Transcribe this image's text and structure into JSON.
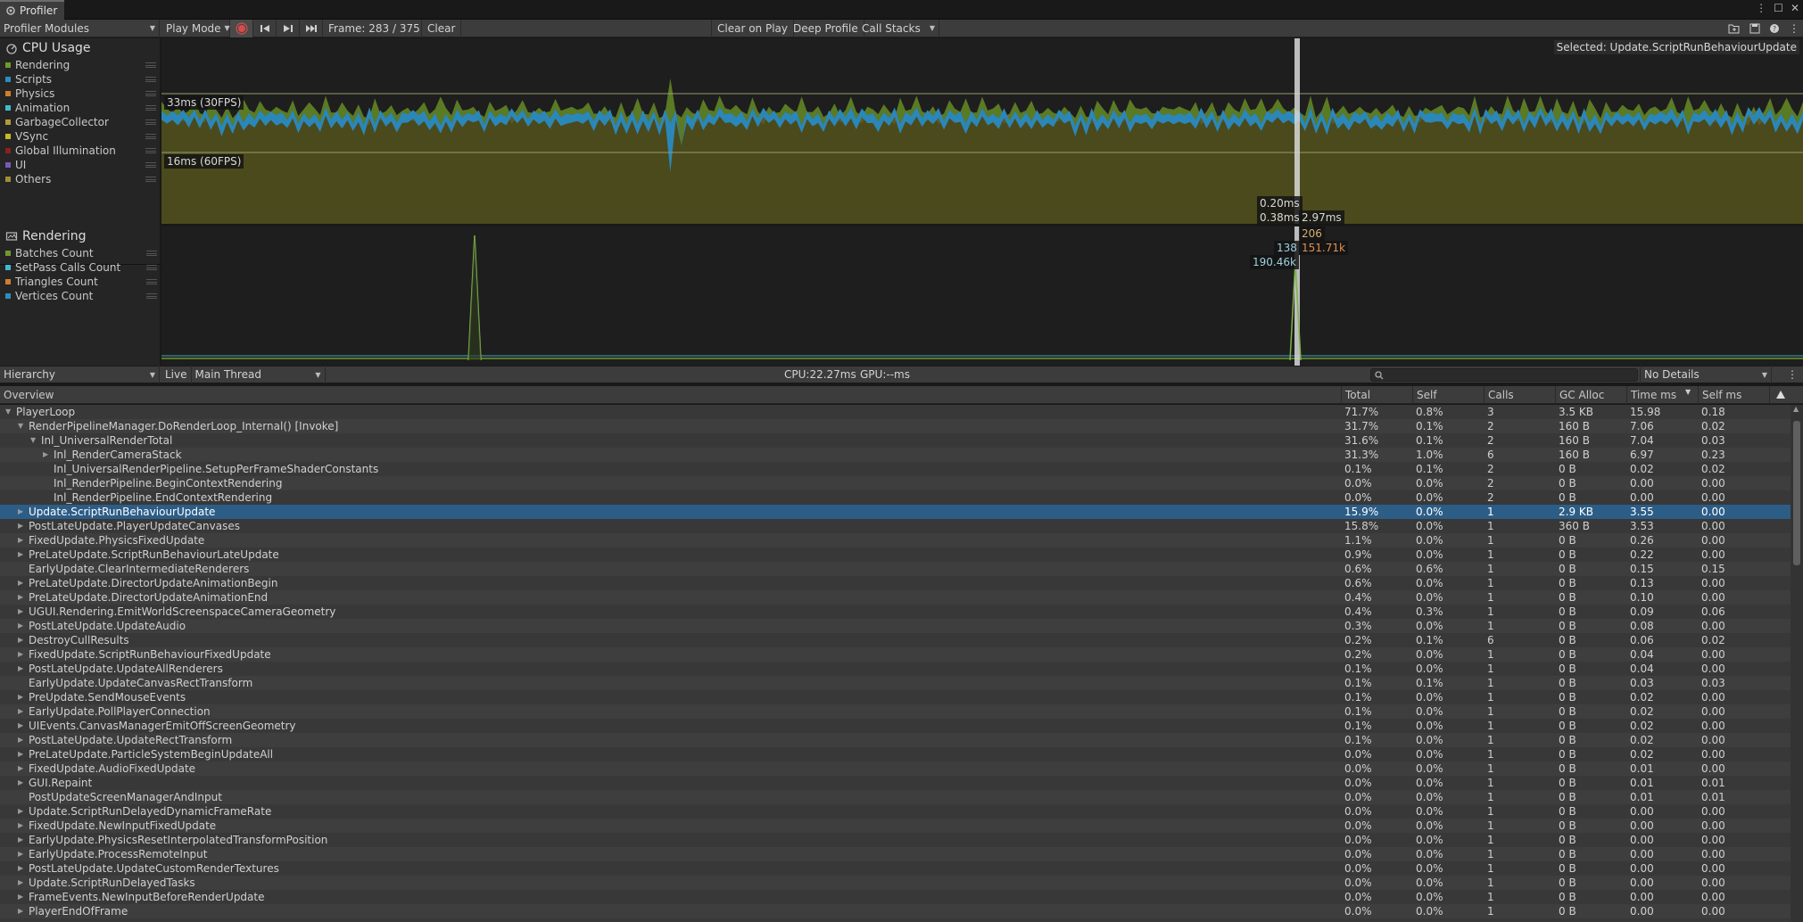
{
  "window": {
    "tab_title": "Profiler"
  },
  "toolbar": {
    "modules_dropdown": "Profiler Modules",
    "play_mode": "Play Mode",
    "frame": "Frame: 283 / 375",
    "clear": "Clear",
    "clear_on_play": "Clear on Play",
    "deep_profile": "Deep Profile",
    "call_stacks": "Call Stacks"
  },
  "cpu_module": {
    "title": "CPU Usage",
    "legend": [
      {
        "label": "Rendering",
        "color": "#6f9a2b"
      },
      {
        "label": "Scripts",
        "color": "#2a8fbf"
      },
      {
        "label": "Physics",
        "color": "#d27d2c"
      },
      {
        "label": "Animation",
        "color": "#3fbad0"
      },
      {
        "label": "GarbageCollector",
        "color": "#b59a3d"
      },
      {
        "label": "VSync",
        "color": "#c9b925"
      },
      {
        "label": "Global Illumination",
        "color": "#8a2020"
      },
      {
        "label": "UI",
        "color": "#7a58b7"
      },
      {
        "label": "Others",
        "color": "#9e8d36"
      }
    ],
    "line_30fps": "33ms (30FPS)",
    "line_60fps": "16ms (60FPS)",
    "selected": "Selected: Update.ScriptRunBehaviourUpdate",
    "values": [
      "0.20ms",
      "0.38ms",
      "2.97ms"
    ]
  },
  "render_module": {
    "title": "Rendering",
    "legend": [
      {
        "label": "Batches Count",
        "color": "#6f9a2b"
      },
      {
        "label": "SetPass Calls Count",
        "color": "#3fbad0"
      },
      {
        "label": "Triangles Count",
        "color": "#d27d2c"
      },
      {
        "label": "Vertices Count",
        "color": "#2a8fbf"
      }
    ],
    "values": [
      "206",
      "138",
      "151.71k",
      "190.46k"
    ]
  },
  "details_bar": {
    "view": "Hierarchy",
    "live": "Live",
    "thread": "Main Thread",
    "cpu": "CPU:22.27ms",
    "gpu": "GPU:--ms",
    "details": "No Details"
  },
  "columns": [
    "Overview",
    "Total",
    "Self",
    "Calls",
    "GC Alloc",
    "Time ms",
    "Self ms"
  ],
  "rows": [
    {
      "name": "PlayerLoop",
      "depth": 0,
      "exp": "open",
      "total": "71.7%",
      "self": "0.8%",
      "calls": "3",
      "gc": "3.5 KB",
      "time": "15.98",
      "selfms": "0.18"
    },
    {
      "name": "RenderPipelineManager.DoRenderLoop_Internal() [Invoke]",
      "depth": 1,
      "exp": "open",
      "total": "31.7%",
      "self": "0.1%",
      "calls": "2",
      "gc": "160 B",
      "time": "7.06",
      "selfms": "0.02"
    },
    {
      "name": "Inl_UniversalRenderTotal",
      "depth": 2,
      "exp": "open",
      "total": "31.6%",
      "self": "0.1%",
      "calls": "2",
      "gc": "160 B",
      "time": "7.04",
      "selfms": "0.03"
    },
    {
      "name": "Inl_RenderCameraStack",
      "depth": 3,
      "exp": "closed",
      "total": "31.3%",
      "self": "1.0%",
      "calls": "6",
      "gc": "160 B",
      "time": "6.97",
      "selfms": "0.23"
    },
    {
      "name": "Inl_UniversalRenderPipeline.SetupPerFrameShaderConstants",
      "depth": 3,
      "exp": "none",
      "total": "0.1%",
      "self": "0.1%",
      "calls": "2",
      "gc": "0 B",
      "time": "0.02",
      "selfms": "0.02"
    },
    {
      "name": "Inl_RenderPipeline.BeginContextRendering",
      "depth": 3,
      "exp": "none",
      "total": "0.0%",
      "self": "0.0%",
      "calls": "2",
      "gc": "0 B",
      "time": "0.00",
      "selfms": "0.00"
    },
    {
      "name": "Inl_RenderPipeline.EndContextRendering",
      "depth": 3,
      "exp": "none",
      "total": "0.0%",
      "self": "0.0%",
      "calls": "2",
      "gc": "0 B",
      "time": "0.00",
      "selfms": "0.00"
    },
    {
      "name": "Update.ScriptRunBehaviourUpdate",
      "depth": 1,
      "exp": "closed",
      "total": "15.9%",
      "self": "0.0%",
      "calls": "1",
      "gc": "2.9 KB",
      "time": "3.55",
      "selfms": "0.00",
      "selected": true
    },
    {
      "name": "PostLateUpdate.PlayerUpdateCanvases",
      "depth": 1,
      "exp": "closed",
      "total": "15.8%",
      "self": "0.0%",
      "calls": "1",
      "gc": "360 B",
      "time": "3.53",
      "selfms": "0.00"
    },
    {
      "name": "FixedUpdate.PhysicsFixedUpdate",
      "depth": 1,
      "exp": "closed",
      "total": "1.1%",
      "self": "0.0%",
      "calls": "1",
      "gc": "0 B",
      "time": "0.26",
      "selfms": "0.00"
    },
    {
      "name": "PreLateUpdate.ScriptRunBehaviourLateUpdate",
      "depth": 1,
      "exp": "closed",
      "total": "0.9%",
      "self": "0.0%",
      "calls": "1",
      "gc": "0 B",
      "time": "0.22",
      "selfms": "0.00"
    },
    {
      "name": "EarlyUpdate.ClearIntermediateRenderers",
      "depth": 1,
      "exp": "none",
      "total": "0.6%",
      "self": "0.6%",
      "calls": "1",
      "gc": "0 B",
      "time": "0.15",
      "selfms": "0.15"
    },
    {
      "name": "PreLateUpdate.DirectorUpdateAnimationBegin",
      "depth": 1,
      "exp": "closed",
      "total": "0.6%",
      "self": "0.0%",
      "calls": "1",
      "gc": "0 B",
      "time": "0.13",
      "selfms": "0.00"
    },
    {
      "name": "PreLateUpdate.DirectorUpdateAnimationEnd",
      "depth": 1,
      "exp": "closed",
      "total": "0.4%",
      "self": "0.0%",
      "calls": "1",
      "gc": "0 B",
      "time": "0.10",
      "selfms": "0.00"
    },
    {
      "name": "UGUI.Rendering.EmitWorldScreenspaceCameraGeometry",
      "depth": 1,
      "exp": "closed",
      "total": "0.4%",
      "self": "0.3%",
      "calls": "1",
      "gc": "0 B",
      "time": "0.09",
      "selfms": "0.06"
    },
    {
      "name": "PostLateUpdate.UpdateAudio",
      "depth": 1,
      "exp": "closed",
      "total": "0.3%",
      "self": "0.0%",
      "calls": "1",
      "gc": "0 B",
      "time": "0.08",
      "selfms": "0.00"
    },
    {
      "name": "DestroyCullResults",
      "depth": 1,
      "exp": "closed",
      "total": "0.2%",
      "self": "0.1%",
      "calls": "6",
      "gc": "0 B",
      "time": "0.06",
      "selfms": "0.02"
    },
    {
      "name": "FixedUpdate.ScriptRunBehaviourFixedUpdate",
      "depth": 1,
      "exp": "closed",
      "total": "0.2%",
      "self": "0.0%",
      "calls": "1",
      "gc": "0 B",
      "time": "0.04",
      "selfms": "0.00"
    },
    {
      "name": "PostLateUpdate.UpdateAllRenderers",
      "depth": 1,
      "exp": "closed",
      "total": "0.1%",
      "self": "0.0%",
      "calls": "1",
      "gc": "0 B",
      "time": "0.04",
      "selfms": "0.00"
    },
    {
      "name": "EarlyUpdate.UpdateCanvasRectTransform",
      "depth": 1,
      "exp": "none",
      "total": "0.1%",
      "self": "0.1%",
      "calls": "1",
      "gc": "0 B",
      "time": "0.03",
      "selfms": "0.03"
    },
    {
      "name": "PreUpdate.SendMouseEvents",
      "depth": 1,
      "exp": "closed",
      "total": "0.1%",
      "self": "0.0%",
      "calls": "1",
      "gc": "0 B",
      "time": "0.02",
      "selfms": "0.00"
    },
    {
      "name": "EarlyUpdate.PollPlayerConnection",
      "depth": 1,
      "exp": "closed",
      "total": "0.1%",
      "self": "0.0%",
      "calls": "1",
      "gc": "0 B",
      "time": "0.02",
      "selfms": "0.00"
    },
    {
      "name": "UIEvents.CanvasManagerEmitOffScreenGeometry",
      "depth": 1,
      "exp": "closed",
      "total": "0.1%",
      "self": "0.0%",
      "calls": "1",
      "gc": "0 B",
      "time": "0.02",
      "selfms": "0.00"
    },
    {
      "name": "PostLateUpdate.UpdateRectTransform",
      "depth": 1,
      "exp": "closed",
      "total": "0.1%",
      "self": "0.0%",
      "calls": "1",
      "gc": "0 B",
      "time": "0.02",
      "selfms": "0.00"
    },
    {
      "name": "PreLateUpdate.ParticleSystemBeginUpdateAll",
      "depth": 1,
      "exp": "closed",
      "total": "0.0%",
      "self": "0.0%",
      "calls": "1",
      "gc": "0 B",
      "time": "0.02",
      "selfms": "0.00"
    },
    {
      "name": "FixedUpdate.AudioFixedUpdate",
      "depth": 1,
      "exp": "closed",
      "total": "0.0%",
      "self": "0.0%",
      "calls": "1",
      "gc": "0 B",
      "time": "0.01",
      "selfms": "0.00"
    },
    {
      "name": "GUI.Repaint",
      "depth": 1,
      "exp": "closed",
      "total": "0.0%",
      "self": "0.0%",
      "calls": "1",
      "gc": "0 B",
      "time": "0.01",
      "selfms": "0.01"
    },
    {
      "name": "PostUpdateScreenManagerAndInput",
      "depth": 1,
      "exp": "none",
      "total": "0.0%",
      "self": "0.0%",
      "calls": "1",
      "gc": "0 B",
      "time": "0.01",
      "selfms": "0.01"
    },
    {
      "name": "Update.ScriptRunDelayedDynamicFrameRate",
      "depth": 1,
      "exp": "closed",
      "total": "0.0%",
      "self": "0.0%",
      "calls": "1",
      "gc": "0 B",
      "time": "0.00",
      "selfms": "0.00"
    },
    {
      "name": "FixedUpdate.NewInputFixedUpdate",
      "depth": 1,
      "exp": "closed",
      "total": "0.0%",
      "self": "0.0%",
      "calls": "1",
      "gc": "0 B",
      "time": "0.00",
      "selfms": "0.00"
    },
    {
      "name": "EarlyUpdate.PhysicsResetInterpolatedTransformPosition",
      "depth": 1,
      "exp": "closed",
      "total": "0.0%",
      "self": "0.0%",
      "calls": "1",
      "gc": "0 B",
      "time": "0.00",
      "selfms": "0.00"
    },
    {
      "name": "EarlyUpdate.ProcessRemoteInput",
      "depth": 1,
      "exp": "closed",
      "total": "0.0%",
      "self": "0.0%",
      "calls": "1",
      "gc": "0 B",
      "time": "0.00",
      "selfms": "0.00"
    },
    {
      "name": "PostLateUpdate.UpdateCustomRenderTextures",
      "depth": 1,
      "exp": "closed",
      "total": "0.0%",
      "self": "0.0%",
      "calls": "1",
      "gc": "0 B",
      "time": "0.00",
      "selfms": "0.00"
    },
    {
      "name": "Update.ScriptRunDelayedTasks",
      "depth": 1,
      "exp": "closed",
      "total": "0.0%",
      "self": "0.0%",
      "calls": "1",
      "gc": "0 B",
      "time": "0.00",
      "selfms": "0.00"
    },
    {
      "name": "FrameEvents.NewInputBeforeRenderUpdate",
      "depth": 1,
      "exp": "closed",
      "total": "0.0%",
      "self": "0.0%",
      "calls": "1",
      "gc": "0 B",
      "time": "0.00",
      "selfms": "0.00"
    },
    {
      "name": "PlayerEndOfFrame",
      "depth": 1,
      "exp": "closed",
      "total": "0.0%",
      "self": "0.0%",
      "calls": "1",
      "gc": "0 B",
      "time": "0.00",
      "selfms": "0.00"
    }
  ]
}
